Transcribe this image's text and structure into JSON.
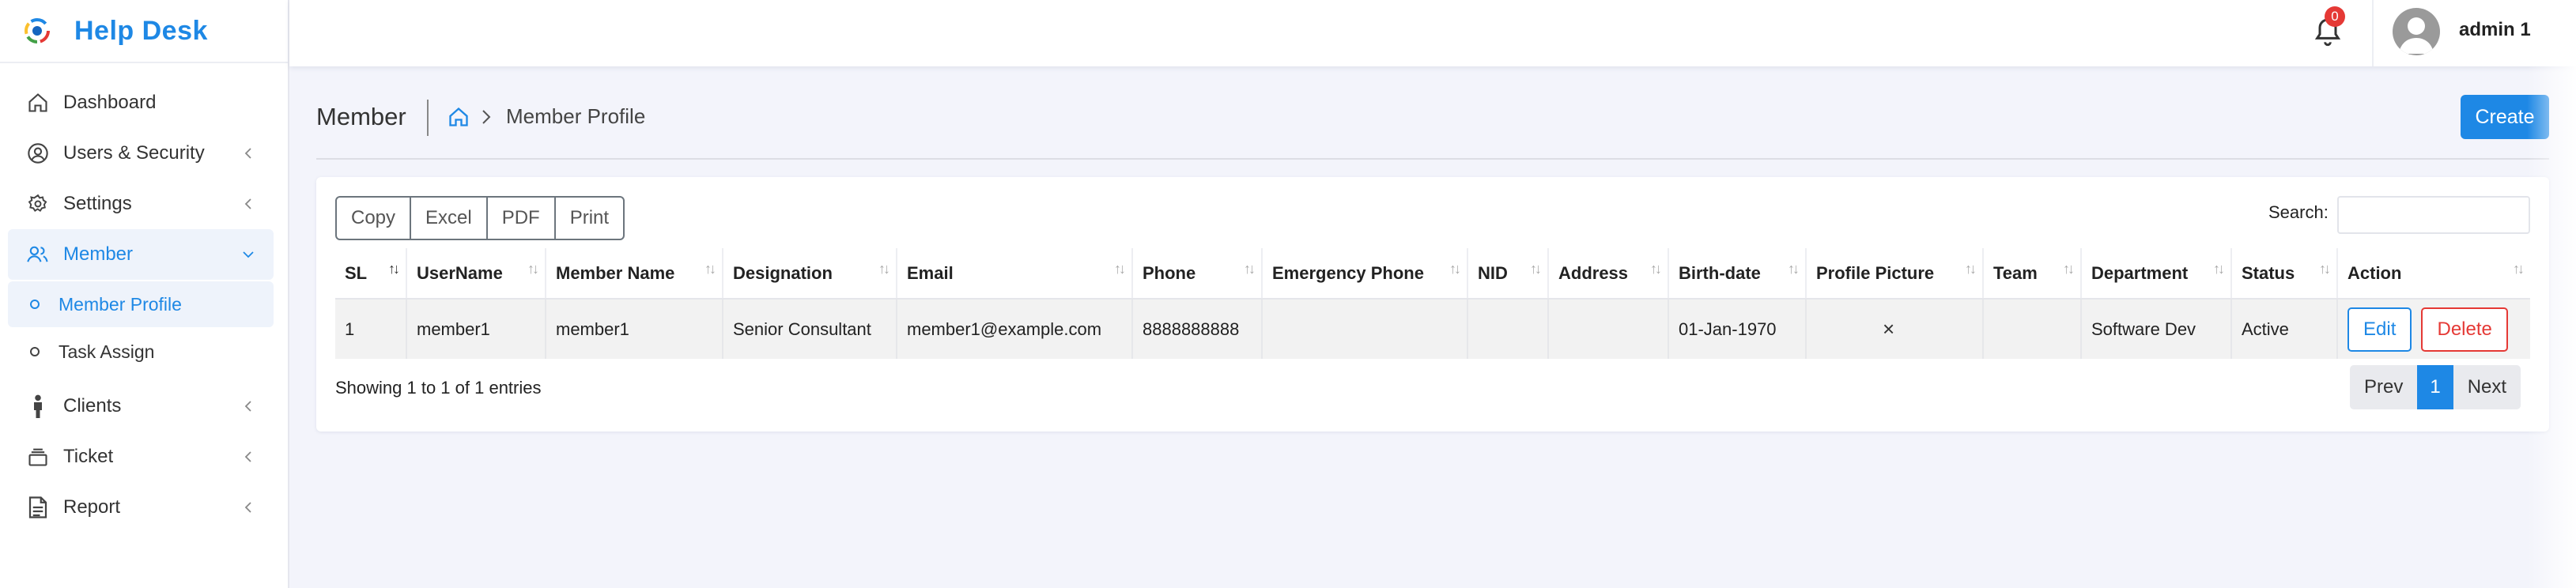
{
  "brand": {
    "name": "Help Desk"
  },
  "sidebar": {
    "items": [
      {
        "label": "Dashboard",
        "icon": "home-icon"
      },
      {
        "label": "Users & Security",
        "icon": "user-circle-icon",
        "has_chevron": true
      },
      {
        "label": "Settings",
        "icon": "gear-icon",
        "has_chevron": true
      },
      {
        "label": "Member",
        "icon": "users-icon",
        "expanded": true
      },
      {
        "label": "Clients",
        "icon": "person-icon",
        "has_chevron": true
      },
      {
        "label": "Ticket",
        "icon": "layers-icon",
        "has_chevron": true
      },
      {
        "label": "Report",
        "icon": "document-icon",
        "has_chevron": true
      }
    ],
    "member_sub": [
      {
        "label": "Member Profile",
        "active": true
      },
      {
        "label": "Task Assign",
        "active": false
      }
    ]
  },
  "topbar": {
    "notification_count": "0",
    "user_name": "admin 1"
  },
  "page": {
    "title": "Member",
    "breadcrumb_current": "Member Profile",
    "create_label": "Create"
  },
  "toolbar": {
    "buttons": [
      "Copy",
      "Excel",
      "PDF",
      "Print"
    ],
    "search_label": "Search:",
    "search_value": ""
  },
  "table": {
    "columns": [
      "SL",
      "UserName",
      "Member Name",
      "Designation",
      "Email",
      "Phone",
      "Emergency Phone",
      "NID",
      "Address",
      "Birth-date",
      "Profile Picture",
      "Team",
      "Department",
      "Status",
      "Action"
    ],
    "rows": [
      {
        "sl": "1",
        "username": "member1",
        "member_name": "member1",
        "designation": "Senior Consultant",
        "email": "member1@example.com",
        "phone": "8888888888",
        "emergency_phone": "",
        "nid": "",
        "address": "",
        "birth_date": "01-Jan-1970",
        "profile_picture": "×",
        "team": "",
        "department": "Software Dev",
        "status": "Active",
        "edit_label": "Edit",
        "delete_label": "Delete"
      }
    ]
  },
  "footer": {
    "info": "Showing 1 to 1 of 1 entries",
    "prev": "Prev",
    "page": "1",
    "next": "Next"
  },
  "colors": {
    "accent": "#1e88e5",
    "danger": "#e53935",
    "background": "#f3f4fb"
  }
}
